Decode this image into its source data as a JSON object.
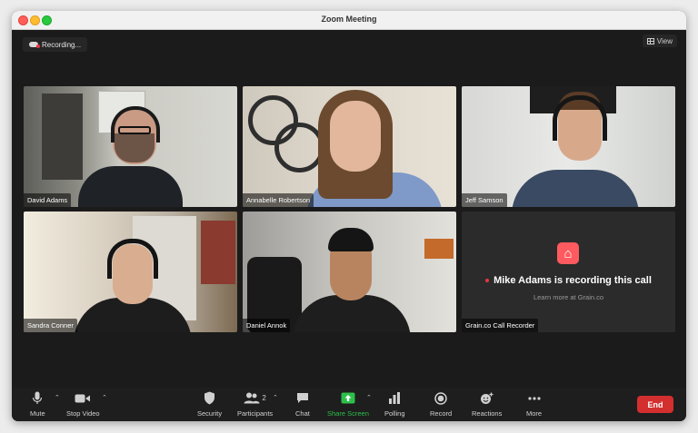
{
  "window": {
    "title": "Zoom Meeting"
  },
  "top": {
    "recording_label": "Recording...",
    "view_label": "View"
  },
  "participants": [
    {
      "name": "David Adams"
    },
    {
      "name": "Annabelle Robertson"
    },
    {
      "name": "Jeff Samson"
    },
    {
      "name": "Sandra Conner"
    },
    {
      "name": "Daniel Annok"
    },
    {
      "name": "Grain.co Call Recorder"
    }
  ],
  "recorder": {
    "logo_icon": "airbnb-logo-icon",
    "message": "Mike Adams is recording this call",
    "sub_message": "Learn more at Grain.co",
    "accent": "#ff5a5f"
  },
  "toolbar": {
    "mute": "Mute",
    "stop_video": "Stop Video",
    "security": "Security",
    "participants": "Participants",
    "participants_count": "2",
    "chat": "Chat",
    "share_screen": "Share Screen",
    "polling": "Polling",
    "record": "Record",
    "reactions": "Reactions",
    "more": "More",
    "end": "End",
    "share_color": "#2dbf4a",
    "end_color": "#d32f2f"
  }
}
